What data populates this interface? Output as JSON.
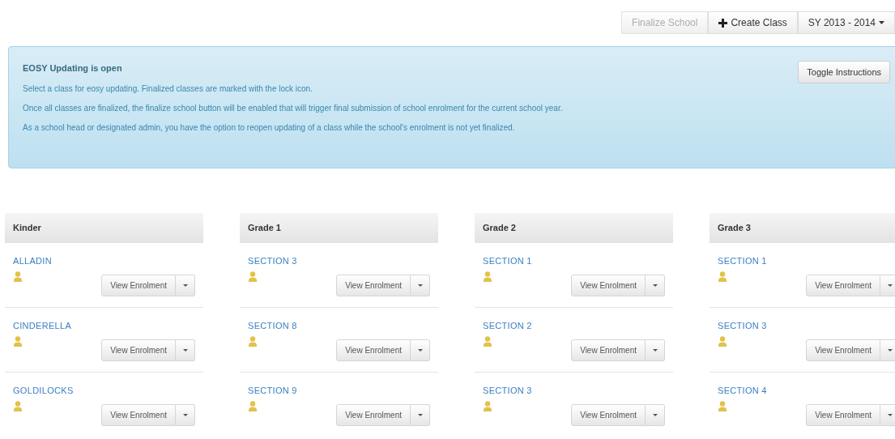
{
  "toolbar": {
    "buttons": [
      {
        "label": "Finalize School",
        "kind": "plain",
        "disabled": true
      },
      {
        "label": "Create Class",
        "kind": "create",
        "disabled": false
      },
      {
        "label": "SY 2013 - 2014",
        "kind": "dropdown",
        "disabled": false
      }
    ]
  },
  "alert": {
    "title": "EOSY Updating is open",
    "toggle_button": "Toggle Instructions",
    "lines": [
      "Select a class for eosy updating. Finalized classes are marked with the lock icon.",
      "Once all classes are finalized, the finalize school button will be enabled that will trigger final submission of school enrolment for the current school year.",
      "As a school head or designated admin, you have the option to reopen updating of a class while the school's enrolment is not yet finalized."
    ]
  },
  "grades": [
    {
      "title": "Kinder",
      "classes": [
        {
          "name": "ALLADIN",
          "button": "View Enrolment"
        },
        {
          "name": "CINDERELLA",
          "button": "View Enrolment"
        },
        {
          "name": "GOLDILOCKS",
          "button": "View Enrolment"
        }
      ]
    },
    {
      "title": "Grade 1",
      "classes": [
        {
          "name": "SECTION 3",
          "button": "View Enrolment"
        },
        {
          "name": "SECTION 8",
          "button": "View Enrolment"
        },
        {
          "name": "SECTION 9",
          "button": "View Enrolment"
        }
      ]
    },
    {
      "title": "Grade 2",
      "classes": [
        {
          "name": "SECTION 1",
          "button": "View Enrolment"
        },
        {
          "name": "SECTION 2",
          "button": "View Enrolment"
        },
        {
          "name": "SECTION 3",
          "button": "View Enrolment"
        }
      ]
    },
    {
      "title": "Grade 3",
      "classes": [
        {
          "name": "SECTION 1",
          "button": "View Enrolment"
        },
        {
          "name": "SECTION 3",
          "button": "View Enrolment"
        },
        {
          "name": "SECTION 4",
          "button": "View Enrolment"
        }
      ]
    }
  ]
}
